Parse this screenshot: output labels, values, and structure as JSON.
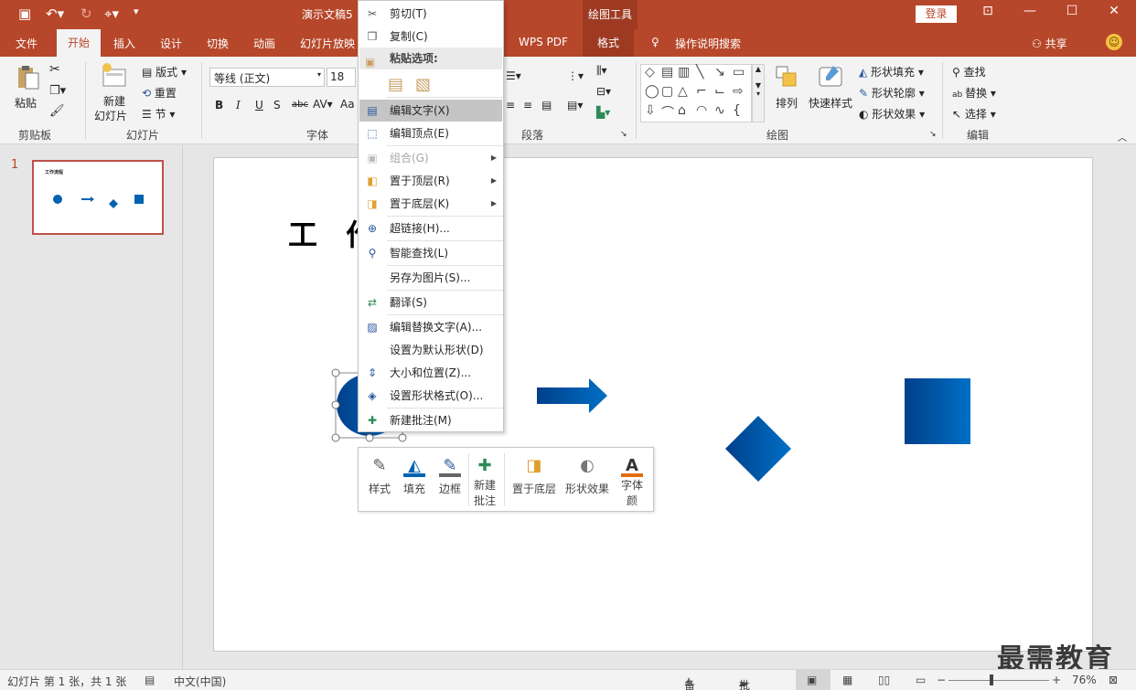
{
  "titlebar": {
    "doc_title": "演示文稿5",
    "context_tool": "绘图工具",
    "login": "登录"
  },
  "tabs": {
    "file": "文件",
    "home": "开始",
    "insert": "插入",
    "design": "设计",
    "transitions": "切换",
    "animations": "动画",
    "slideshow": "幻灯片放映",
    "wps_pdf": "WPS PDF",
    "format": "格式",
    "search": "操作说明搜索",
    "share": "共享"
  },
  "ribbon": {
    "paste": "粘贴",
    "clipboard": "剪贴板",
    "new_slide_1": "新建",
    "new_slide_2": "幻灯片",
    "layout": "版式",
    "reset": "重置",
    "section": "节",
    "slides_group": "幻灯片",
    "font_name": "等线 (正文)",
    "font_size": "18",
    "font_group": "字体",
    "paragraph_group": "段落",
    "arrange": "排列",
    "quick_styles": "快速样式",
    "shape_fill": "形状填充",
    "shape_outline": "形状轮廓",
    "shape_effects": "形状效果",
    "drawing_group": "绘图",
    "find": "查找",
    "replace": "替换",
    "select": "选择",
    "editing_group": "编辑"
  },
  "thumbnail": {
    "number": "1",
    "title": "工作流程"
  },
  "slide": {
    "title_visible": "工 作"
  },
  "context_menu": {
    "cut": "剪切(T)",
    "copy": "复制(C)",
    "paste_options": "粘贴选项:",
    "edit_text": "编辑文字(X)",
    "edit_points": "编辑顶点(E)",
    "group": "组合(G)",
    "bring_front": "置于顶层(R)",
    "send_back": "置于底层(K)",
    "hyperlink": "超链接(H)...",
    "smart_lookup": "智能查找(L)",
    "save_as_picture": "另存为图片(S)...",
    "translate": "翻译(S)",
    "edit_alt_text": "编辑替换文字(A)...",
    "set_default_shape": "设置为默认形状(D)",
    "size_position": "大小和位置(Z)...",
    "format_shape": "设置形状格式(O)...",
    "new_comment": "新建批注(M)"
  },
  "mini_toolbar": {
    "style": "样式",
    "fill": "填充",
    "outline": "边框",
    "new_comment_1": "新建",
    "new_comment_2": "批注",
    "send_back": "置于底层",
    "shape_effects": "形状效果",
    "font_color_1": "字体",
    "font_color_2": "颜"
  },
  "statusbar": {
    "slide_info": "幻灯片 第 1 张，共 1 张",
    "language": "中文(中国)",
    "notes": "备注",
    "comments": "批注",
    "zoom": "76%"
  },
  "watermark": "最需教育",
  "colors": {
    "accent": "#b7472a",
    "shape_blue": "#0062b0"
  }
}
